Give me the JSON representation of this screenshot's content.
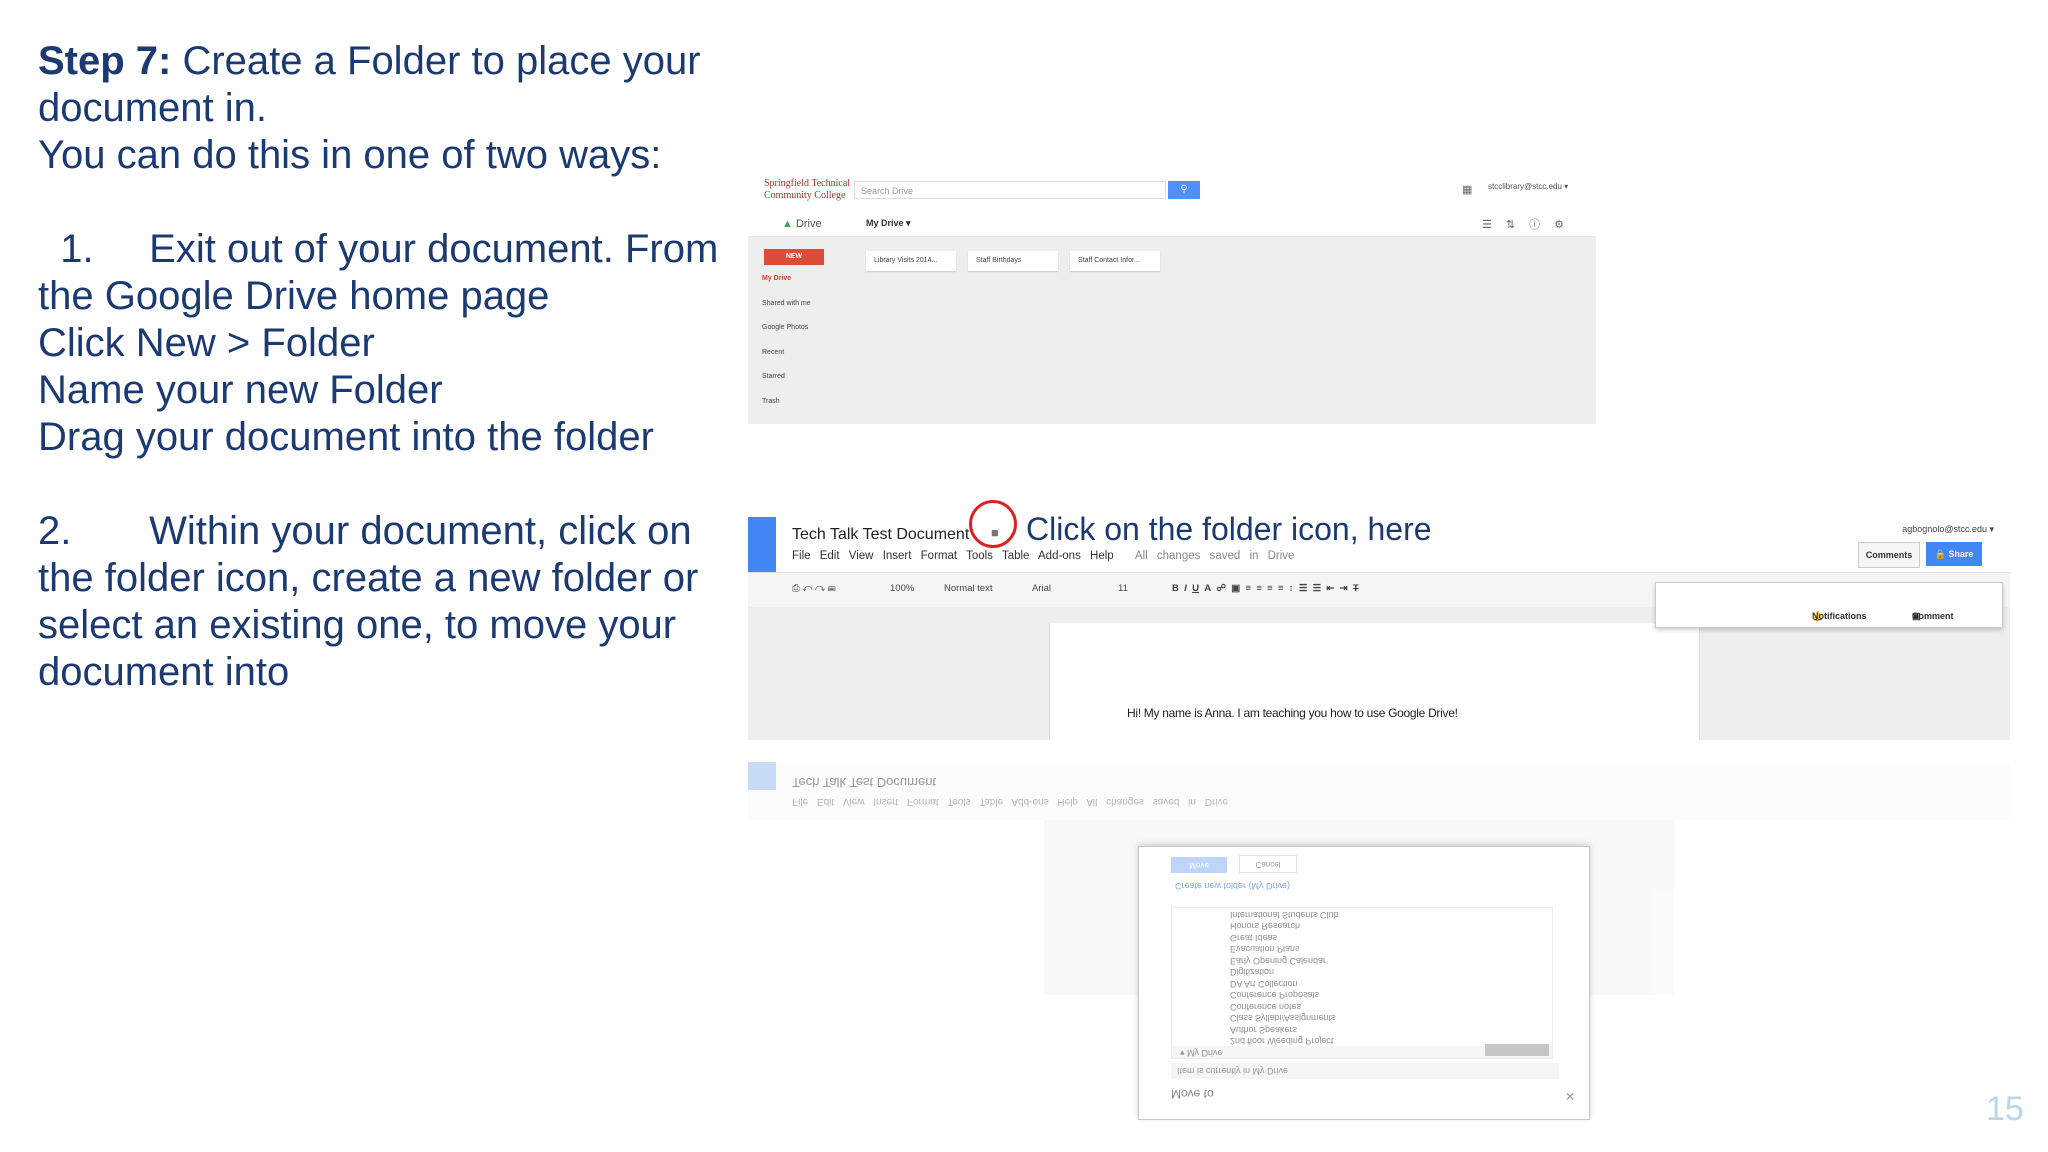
{
  "instructions": {
    "step_label": "Step 7:",
    "step_text": " Create a Folder to place your document in.",
    "intro": "You can do this in one of two ways:",
    "method1_num": "1.",
    "method1_text": "Exit out of your document. From the Google Drive home page",
    "method1_line2": "Click New > Folder",
    "method1_line3": "Name your new Folder",
    "method1_line4": "Drag your document into the folder",
    "method2_num": "2.",
    "method2_text": "Within your document, click on the folder icon, create a new folder or select an existing one, to move your document into"
  },
  "drive": {
    "logo_line1": "Springfield Technical",
    "logo_line2": "Community College",
    "search_placeholder": "Search Drive",
    "account": "stcclibrary@stcc.edu ▾",
    "app_name": "Drive",
    "my_drive_menu": "My Drive ▾",
    "new_button": "NEW",
    "nav": [
      "My Drive",
      "Shared with me",
      "Google Photos",
      "Recent",
      "Starred",
      "Trash"
    ],
    "files": [
      "Library Visits 2014...",
      "Staff Birthdays",
      "Staff Contact Infor..."
    ]
  },
  "docs": {
    "title": "Tech Talk Test Document",
    "menu": [
      "File",
      "Edit",
      "View",
      "Insert",
      "Format",
      "Tools",
      "Table",
      "Add-ons",
      "Help"
    ],
    "saved_status": "All changes saved in Drive",
    "callout": "Click on the folder icon, here",
    "account": "agbognolo@stcc.edu ▾",
    "comments_button": "Comments",
    "share_button": "Share",
    "toolbar": {
      "zoom": "100%",
      "style": "Normal text",
      "font": "Arial",
      "size": "11"
    },
    "notifications": "Notifications",
    "comment": "Comment",
    "body_text": "Hi! My name is Anna. I am teaching you how to use Google Drive!"
  },
  "move_dialog": {
    "title": "Move to",
    "current": "Item is currently in   My Drive",
    "folders": [
      "▾ My Drive",
      "2nd floor Weeding Project",
      "Author Speakers",
      "Class Syllabi/Assignments",
      "Conference notes",
      "Conference Proposals",
      "DA Art Collection",
      "Digitization",
      "Early Opening Calendar",
      "Evacuation Plans",
      "Great Ideas",
      "Honors Research",
      "International Students Club"
    ],
    "create_link": "Create new folder (My Drive)",
    "move_button": "Move",
    "cancel_button": "Cancel"
  },
  "page_number": "15"
}
